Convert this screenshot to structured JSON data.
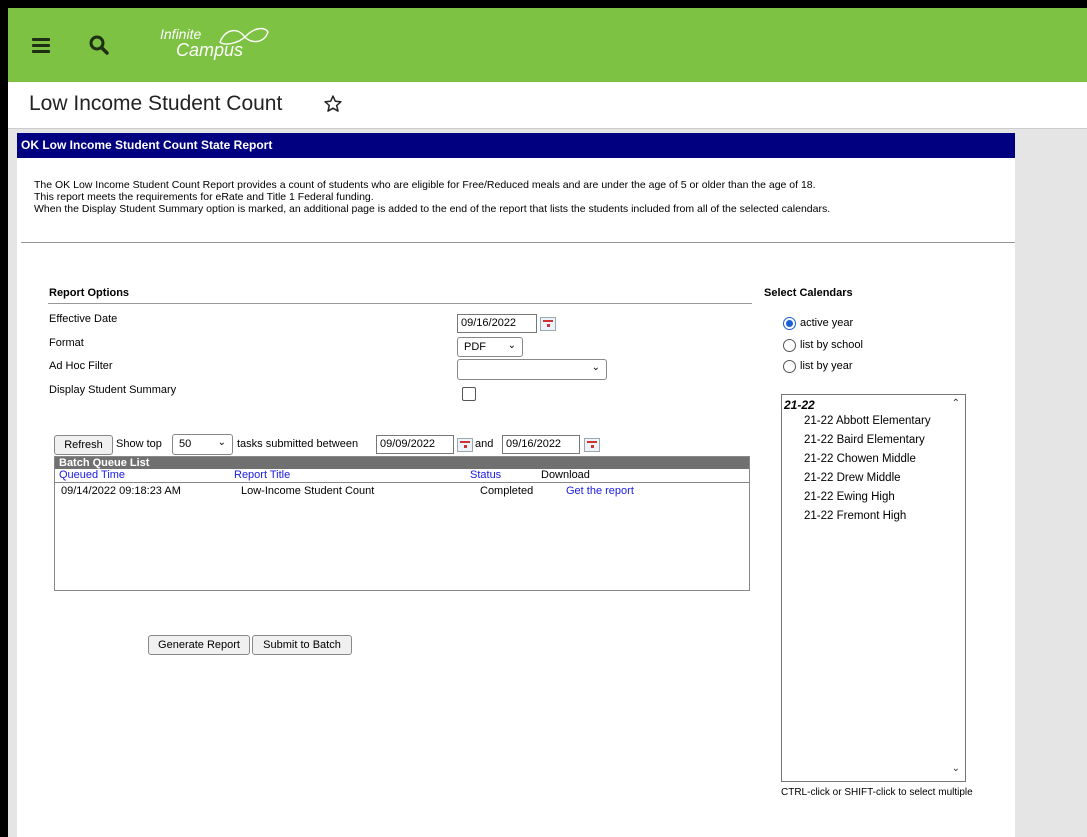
{
  "app": {
    "logo_line1": "Infinite",
    "logo_line2": "Campus",
    "menu_icon": "hamburger-icon",
    "search_icon": "search-icon"
  },
  "page": {
    "title": "Low Income Student Count",
    "favorite_icon": "star-outline-icon"
  },
  "report": {
    "header": "OK Low Income Student Count State Report",
    "description": [
      "The OK Low Income Student Count Report provides a count of students who are eligible for Free/Reduced meals and are under the age of 5 or older than the age of 18.",
      "This report meets the requirements for eRate and Title 1 Federal funding.",
      "When the Display Student Summary option is marked, an additional page is added to the end of the report that lists the students included from all of the selected calendars."
    ]
  },
  "options": {
    "title": "Report Options",
    "effective_date_label": "Effective Date",
    "effective_date_value": "09/16/2022",
    "format_label": "Format",
    "format_value": "PDF",
    "adhoc_label": "Ad Hoc Filter",
    "adhoc_value": "",
    "summary_label": "Display Student Summary",
    "summary_checked": false
  },
  "batch": {
    "refresh_label": "Refresh",
    "show_top_label": "Show top",
    "show_top_value": "50",
    "between_label": "tasks submitted between",
    "start_date": "09/09/2022",
    "and_label": "and",
    "end_date": "09/16/2022",
    "list_title": "Batch Queue List",
    "columns": [
      "Queued Time",
      "Report Title",
      "Status",
      "Download"
    ],
    "rows": [
      {
        "queued": "09/14/2022 09:18:23 AM",
        "title": "Low-Income Student Count",
        "status": "Completed",
        "download": "Get the report"
      }
    ]
  },
  "actions": {
    "generate_label": "Generate Report",
    "submit_label": "Submit to Batch"
  },
  "calendars": {
    "title": "Select Calendars",
    "radios": [
      {
        "label": "active year",
        "selected": true
      },
      {
        "label": "list by school",
        "selected": false
      },
      {
        "label": "list by year",
        "selected": false
      }
    ],
    "group": "21-22",
    "items": [
      "21-22 Abbott Elementary",
      "21-22 Baird Elementary",
      "21-22 Chowen Middle",
      "21-22 Drew Middle",
      "21-22 Ewing High",
      "21-22 Fremont High"
    ],
    "hint": "CTRL-click or SHIFT-click to select multiple"
  },
  "colors": {
    "topbar": "#7dc242",
    "header_bar": "#000080",
    "batch_title_bar": "#707070",
    "link": "#1a1ae0"
  }
}
